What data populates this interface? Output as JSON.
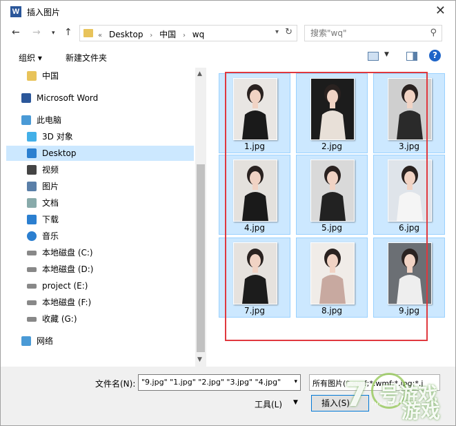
{
  "window": {
    "title": "插入图片",
    "app_icon": "W"
  },
  "nav": {
    "crumbs": [
      "Desktop",
      "中国",
      "wq"
    ],
    "search_placeholder": "搜索\"wq\""
  },
  "toolbar": {
    "organize": "组织 ▾",
    "new_folder": "新建文件夹",
    "help": "?"
  },
  "sidebar": {
    "items": [
      {
        "label": "中国",
        "icon": "folder-icon",
        "indent": 30,
        "color": "#e8c35a"
      },
      {
        "label": "Microsoft Word",
        "icon": "word-icon",
        "indent": 22,
        "color": "#2b579a"
      },
      {
        "label": "此电脑",
        "icon": "computer-icon",
        "indent": 22,
        "color": "#4a9ad6"
      },
      {
        "label": "3D 对象",
        "icon": "3d-objects-icon",
        "indent": 30,
        "color": "#43b0e8"
      },
      {
        "label": "Desktop",
        "icon": "desktop-icon",
        "indent": 30,
        "color": "#2b7fd0",
        "selected": true
      },
      {
        "label": "视频",
        "icon": "video-icon",
        "indent": 30,
        "color": "#444"
      },
      {
        "label": "图片",
        "icon": "pictures-icon",
        "indent": 30,
        "color": "#5a7fa8"
      },
      {
        "label": "文档",
        "icon": "documents-icon",
        "indent": 30,
        "color": "#8aa"
      },
      {
        "label": "下载",
        "icon": "downloads-icon",
        "indent": 30,
        "color": "#2b7fd0"
      },
      {
        "label": "音乐",
        "icon": "music-icon",
        "indent": 30,
        "color": "#2b7fd0"
      },
      {
        "label": "本地磁盘 (C:)",
        "icon": "drive-c-icon",
        "indent": 30,
        "color": "#888"
      },
      {
        "label": "本地磁盘 (D:)",
        "icon": "drive-icon",
        "indent": 30,
        "color": "#888"
      },
      {
        "label": "project (E:)",
        "icon": "drive-icon",
        "indent": 30,
        "color": "#888"
      },
      {
        "label": "本地磁盘 (F:)",
        "icon": "drive-icon",
        "indent": 30,
        "color": "#888"
      },
      {
        "label": "收藏 (G:)",
        "icon": "drive-icon",
        "indent": 30,
        "color": "#888"
      },
      {
        "label": "网络",
        "icon": "network-icon",
        "indent": 22,
        "color": "#4a9ad6"
      }
    ]
  },
  "files": [
    {
      "name": "1.jpg",
      "bg": "#e9e6e3",
      "fg": "#1a1a1a"
    },
    {
      "name": "2.jpg",
      "bg": "#1c1c1c",
      "fg": "#e8e0d8"
    },
    {
      "name": "3.jpg",
      "bg": "#cfcfcf",
      "fg": "#2a2a2a"
    },
    {
      "name": "4.jpg",
      "bg": "#e4e1dd",
      "fg": "#1a1a1a"
    },
    {
      "name": "5.jpg",
      "bg": "#d9d9d9",
      "fg": "#222"
    },
    {
      "name": "6.jpg",
      "bg": "#dfe4ea",
      "fg": "#f5f5f5"
    },
    {
      "name": "7.jpg",
      "bg": "#e6e2de",
      "fg": "#1c1c1c"
    },
    {
      "name": "8.jpg",
      "bg": "#f0ece8",
      "fg": "#c8a9a0"
    },
    {
      "name": "9.jpg",
      "bg": "#6b6f74",
      "fg": "#eee"
    }
  ],
  "bottom": {
    "filename_label": "文件名(N):",
    "filename_value": "\"9.jpg\" \"1.jpg\" \"2.jpg\" \"3.jpg\" \"4.jpg\"",
    "filetype_value": "所有图片(*.emf;*.wmf;*.jpg;*.j",
    "tools": "工具(L)",
    "insert": "插入(S)"
  },
  "watermark": {
    "num": "7",
    "cn1": "号游戏",
    "cn2": "游戏",
    "latin": "7HAOYOUXIWANG"
  }
}
